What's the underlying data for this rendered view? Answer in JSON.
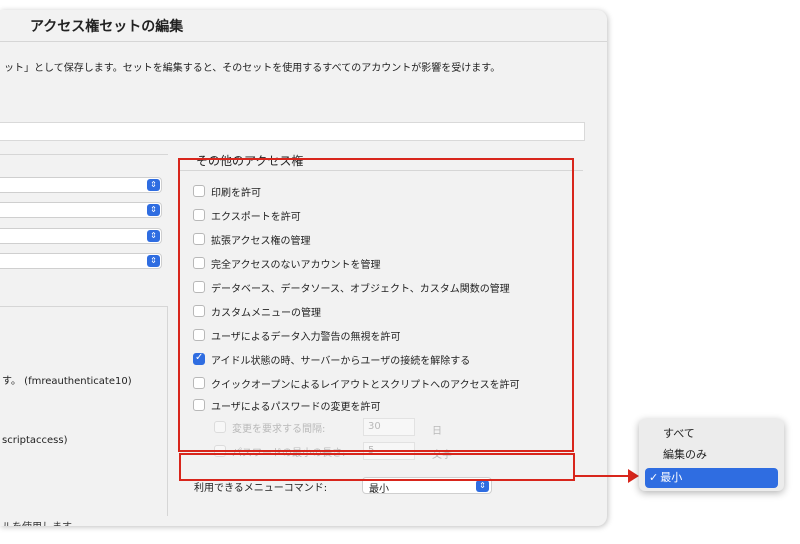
{
  "dialog": {
    "title": "アクセス権セットの編集",
    "description": "ット」として保存します。セットを編集すると、そのセットを使用するすべてのアカウントが影響を受けます。",
    "left_texts": [
      "す。 (fmreauthenticate10)",
      "scriptaccess)"
    ],
    "footnote": "ルを使用します。"
  },
  "other_privileges": {
    "title": "その他のアクセス権",
    "items": [
      {
        "label": "印刷を許可",
        "checked": false
      },
      {
        "label": "エクスポートを許可",
        "checked": false
      },
      {
        "label": "拡張アクセス権の管理",
        "checked": false
      },
      {
        "label": "完全アクセスのないアカウントを管理",
        "checked": false
      },
      {
        "label": "データベース、データソース、オブジェクト、カスタム関数の管理",
        "checked": false
      },
      {
        "label": "カスタムメニューの管理",
        "checked": false
      },
      {
        "label": "ユーザによるデータ入力警告の無視を許可",
        "checked": false
      },
      {
        "label": "アイドル状態の時、サーバーからユーザの接続を解除する",
        "checked": true
      },
      {
        "label": "クイックオープンによるレイアウトとスクリプトへのアクセスを許可",
        "checked": false
      },
      {
        "label": "ユーザによるパスワードの変更を許可",
        "checked": false
      }
    ],
    "password_change_interval": {
      "label": "変更を要求する間隔:",
      "value": "30",
      "unit": "日"
    },
    "password_min_length": {
      "label": "パスワードの最小の長さ:",
      "value": "5",
      "unit": "文字"
    }
  },
  "menu_commands": {
    "label": "利用できるメニューコマンド:",
    "selected": "最小",
    "options": [
      "すべて",
      "編集のみ",
      "最小"
    ]
  },
  "colors": {
    "accent": "#2f6de1",
    "highlight": "#d8261c"
  }
}
